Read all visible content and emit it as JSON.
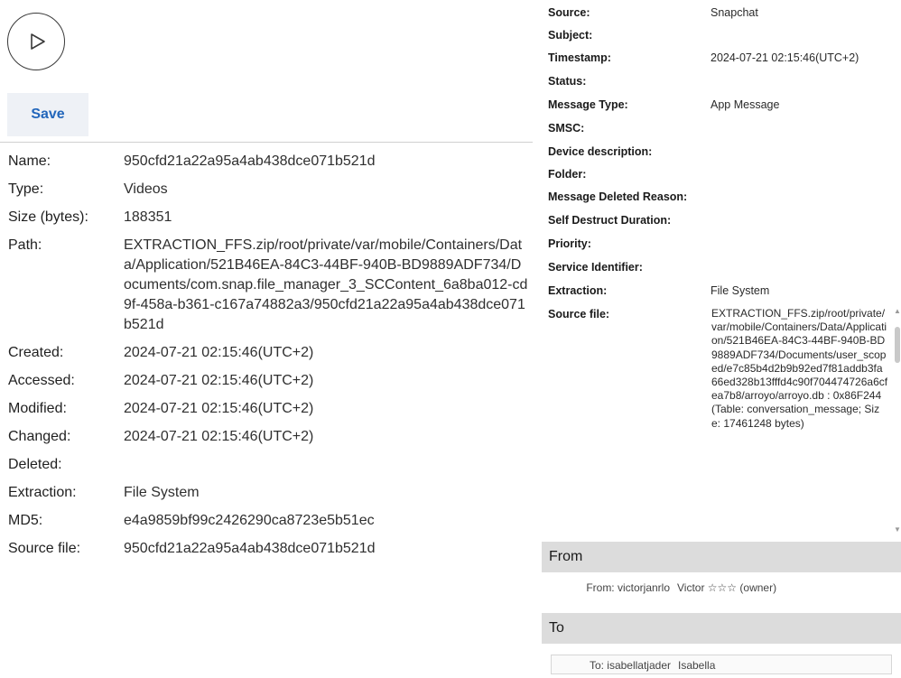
{
  "media": {
    "play_icon": "play-icon",
    "save_label": "Save"
  },
  "file_props": [
    {
      "label": "Name:",
      "value": "950cfd21a22a95a4ab438dce071b521d"
    },
    {
      "label": "Type:",
      "value": "Videos"
    },
    {
      "label": "Size (bytes):",
      "value": "188351"
    },
    {
      "label": "Path:",
      "value": "EXTRACTION_FFS.zip/root/private/var/mobile/Containers/Data/Application/521B46EA-84C3-44BF-940B-BD9889ADF734/Documents/com.snap.file_manager_3_SCContent_6a8ba012-cd9f-458a-b361-c167a74882a3/950cfd21a22a95a4ab438dce071b521d"
    },
    {
      "label": "Created:",
      "value": "2024-07-21 02:15:46(UTC+2)"
    },
    {
      "label": "Accessed:",
      "value": "2024-07-21 02:15:46(UTC+2)"
    },
    {
      "label": "Modified:",
      "value": "2024-07-21 02:15:46(UTC+2)"
    },
    {
      "label": "Changed:",
      "value": "2024-07-21 02:15:46(UTC+2)"
    },
    {
      "label": "Deleted:",
      "value": ""
    },
    {
      "label": "Extraction:",
      "value": "File System"
    },
    {
      "label": "MD5:",
      "value": "e4a9859bf99c2426290ca8723e5b51ec"
    },
    {
      "label": "Source file:",
      "value": "950cfd21a22a95a4ab438dce071b521d"
    }
  ],
  "message_props": [
    {
      "label": "Source:",
      "value": "Snapchat"
    },
    {
      "label": "Subject:",
      "value": ""
    },
    {
      "label": "Timestamp:",
      "value": "2024-07-21 02:15:46(UTC+2)"
    },
    {
      "label": "Status:",
      "value": ""
    },
    {
      "label": "Message Type:",
      "value": "App Message"
    },
    {
      "label": "SMSC:",
      "value": ""
    },
    {
      "label": "Device description:",
      "value": ""
    },
    {
      "label": "Folder:",
      "value": ""
    },
    {
      "label": "Message Deleted Reason:",
      "value": ""
    },
    {
      "label": "Self Destruct Duration:",
      "value": ""
    },
    {
      "label": "Priority:",
      "value": ""
    },
    {
      "label": "Service Identifier:",
      "value": ""
    },
    {
      "label": "Extraction:",
      "value": "File System"
    },
    {
      "label": "Source file:",
      "value": ""
    }
  ],
  "source_file_text": "EXTRACTION_FFS.zip/root/private/var/mobile/Containers/Data/Application/521B46EA-84C3-44BF-940B-BD9889ADF734/Documents/user_scoped/e7c85b4d2b9b92ed7f81addb3fa66ed328b13fffd4c90f704474726a6cfea7b8/arroyo/arroyo.db : 0x86F244 (Table: conversation_message; Size: 17461248 bytes)",
  "from": {
    "heading": "From",
    "label": "From: victorjanrlo",
    "name": "Victor ☆☆☆ (owner)"
  },
  "to": {
    "heading": "To",
    "label": "To: isabellatjader",
    "name": "Isabella"
  }
}
